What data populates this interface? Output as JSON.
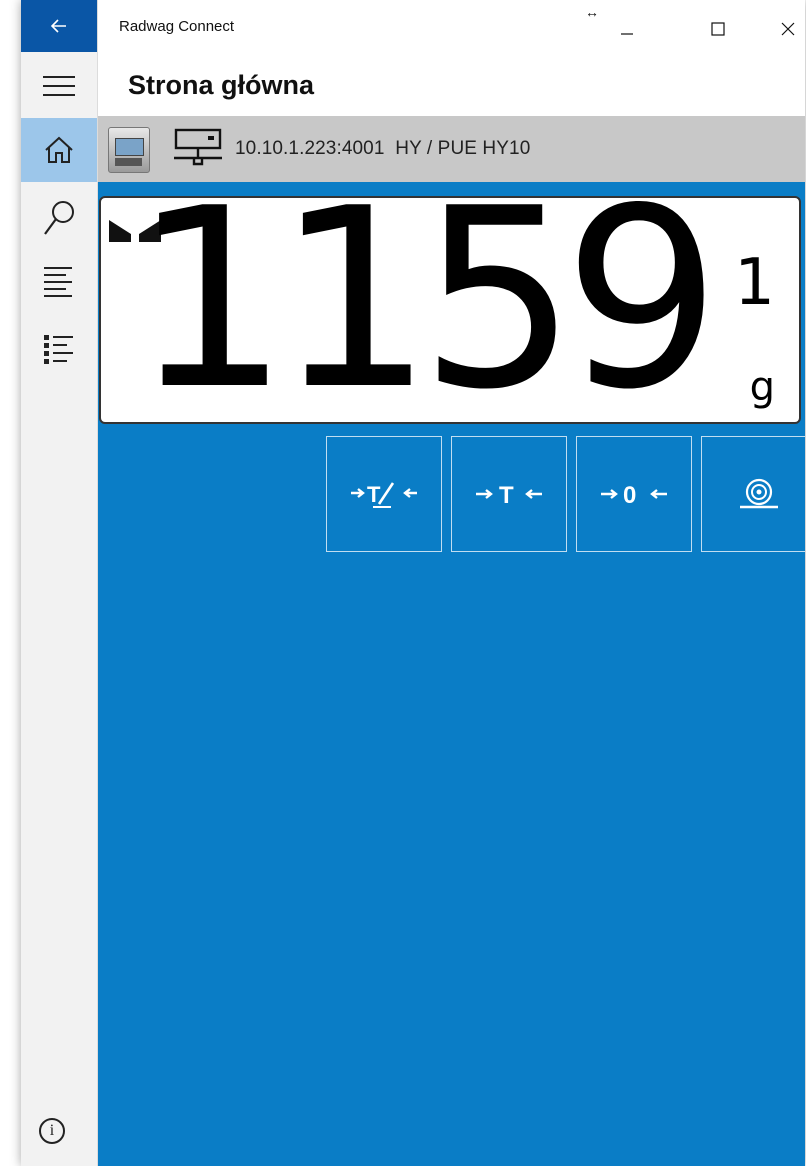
{
  "window": {
    "app_title": "Radwag Connect",
    "resize_glyph": "↔"
  },
  "page": {
    "title": "Strona główna"
  },
  "device": {
    "address": "10.10.1.223:4001",
    "model": "HY / PUE HY10"
  },
  "reading": {
    "value": "1159",
    "last_digit": "1",
    "unit": "g"
  },
  "info_label": "i",
  "colors": {
    "accent": "#0a56a6",
    "main_bg": "#0a7dc6",
    "rail_bg": "#f2f2f2",
    "rail_active": "#9cc6ea",
    "device_bar": "#c8c8c8"
  },
  "icons": {
    "back": "back-arrow-icon",
    "menu": "hamburger-icon",
    "home": "home-icon",
    "search": "search-icon",
    "list": "list-icon",
    "list_detail": "list-detail-icon",
    "info": "info-icon",
    "keys": [
      "tare-set-icon",
      "tare-icon",
      "zero-icon",
      "print-icon"
    ]
  }
}
